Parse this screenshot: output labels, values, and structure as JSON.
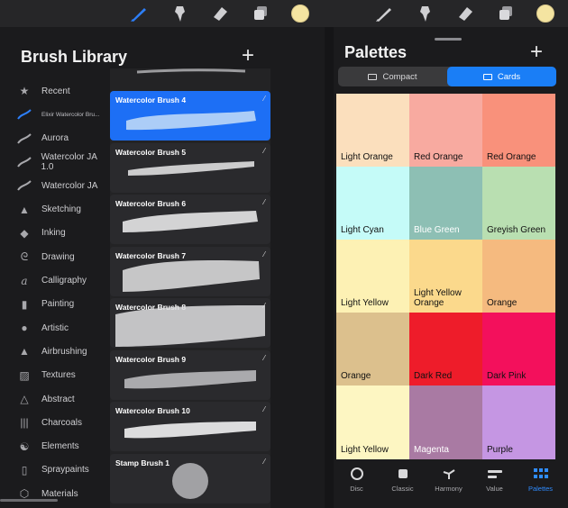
{
  "toolbar_left": {
    "icons": [
      "brush-icon",
      "smudge-icon",
      "eraser-icon",
      "layers-icon"
    ],
    "color": "#f4e4a1"
  },
  "toolbar_right": {
    "icons": [
      "brush-icon",
      "smudge-icon",
      "eraser-icon",
      "layers-icon"
    ],
    "color": "#f4e4a1"
  },
  "brush_library": {
    "title": "Brush Library",
    "add_label": "+",
    "categories": [
      {
        "label": "Recent",
        "icon": "star-icon"
      },
      {
        "label": "Elixir Watercolor Bru...",
        "icon": "blue-stroke-icon"
      },
      {
        "label": "Aurora",
        "icon": "stroke-icon"
      },
      {
        "label": "Watercolor JA 1.0",
        "icon": "stroke-icon"
      },
      {
        "label": "Watercolor JA",
        "icon": "stroke-icon"
      },
      {
        "label": "Sketching",
        "icon": "pencil-tip-icon"
      },
      {
        "label": "Inking",
        "icon": "ink-drop-icon"
      },
      {
        "label": "Drawing",
        "icon": "swirl-icon"
      },
      {
        "label": "Calligraphy",
        "icon": "calligraphy-icon"
      },
      {
        "label": "Painting",
        "icon": "paint-brush-icon"
      },
      {
        "label": "Artistic",
        "icon": "palette-icon"
      },
      {
        "label": "Airbrushing",
        "icon": "airbrush-icon"
      },
      {
        "label": "Textures",
        "icon": "texture-icon"
      },
      {
        "label": "Abstract",
        "icon": "triangle-icon"
      },
      {
        "label": "Charcoals",
        "icon": "charcoal-icon"
      },
      {
        "label": "Elements",
        "icon": "yin-yang-icon"
      },
      {
        "label": "Spraypaints",
        "icon": "spray-icon"
      },
      {
        "label": "Materials",
        "icon": "cube-icon"
      }
    ],
    "brushes": [
      {
        "name": "Watercolor Brush 4",
        "selected": true
      },
      {
        "name": "Watercolor Brush 5",
        "selected": false
      },
      {
        "name": "Watercolor Brush 6",
        "selected": false
      },
      {
        "name": "Watercolor Brush 7",
        "selected": false
      },
      {
        "name": "Watercolor Brush 8",
        "selected": false
      },
      {
        "name": "Watercolor Brush 9",
        "selected": false
      },
      {
        "name": "Watercolor Brush 10",
        "selected": false
      },
      {
        "name": "Stamp Brush 1",
        "selected": false
      }
    ]
  },
  "palettes": {
    "title": "Palettes",
    "add_label": "+",
    "segments": [
      {
        "label": "Compact",
        "active": false
      },
      {
        "label": "Cards",
        "active": true
      }
    ],
    "colors": [
      {
        "label": "Light Orange",
        "hex": "#fbdfbd",
        "text": "#111111"
      },
      {
        "label": "Red Orange",
        "hex": "#f8aaa0",
        "text": "#111111"
      },
      {
        "label": "Red Orange",
        "hex": "#f9917b",
        "text": "#111111"
      },
      {
        "label": "Light Cyan",
        "hex": "#c5fbf8",
        "text": "#111111"
      },
      {
        "label": "Blue Green",
        "hex": "#8dbfb4",
        "text": "#ffffff"
      },
      {
        "label": "Greyish Green",
        "hex": "#b9dfb1",
        "text": "#111111"
      },
      {
        "label": "Light Yellow",
        "hex": "#fdf1b4",
        "text": "#111111"
      },
      {
        "label": "Light Yellow Orange",
        "hex": "#fbd98c",
        "text": "#111111"
      },
      {
        "label": "Orange",
        "hex": "#f5ba7f",
        "text": "#111111"
      },
      {
        "label": "Orange",
        "hex": "#dcc08d",
        "text": "#111111"
      },
      {
        "label": "Dark Red",
        "hex": "#ee1c2a",
        "text": "#111111"
      },
      {
        "label": "Dark Pink",
        "hex": "#f3105c",
        "text": "#111111"
      },
      {
        "label": "Light Yellow",
        "hex": "#fdf6c2",
        "text": "#111111"
      },
      {
        "label": "Magenta",
        "hex": "#a97aa3",
        "text": "#ffffff"
      },
      {
        "label": "Purple",
        "hex": "#c596e3",
        "text": "#111111"
      }
    ],
    "tabs": [
      {
        "label": "Disc",
        "active": false
      },
      {
        "label": "Classic",
        "active": false
      },
      {
        "label": "Harmony",
        "active": false
      },
      {
        "label": "Value",
        "active": false
      },
      {
        "label": "Palettes",
        "active": true
      }
    ]
  }
}
